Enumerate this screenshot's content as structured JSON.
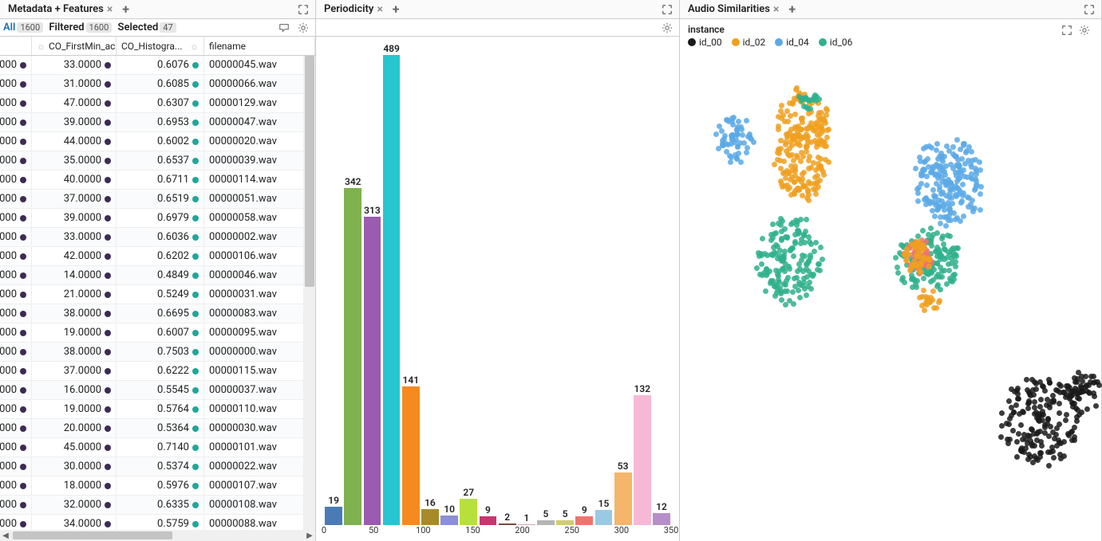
{
  "panels": {
    "left": {
      "title": "Metadata + Features"
    },
    "mid": {
      "title": "Periodicity"
    },
    "right": {
      "title": "Audio Similarities"
    }
  },
  "filters": {
    "all_label": "All",
    "all_count": "1600",
    "filtered_label": "Filtered",
    "filtered_count": "1600",
    "selected_label": "Selected",
    "selected_count": "47"
  },
  "table": {
    "headers": {
      "a": "CO_FirstMin_ac",
      "b": "CO_Histogra...",
      "c": "filename"
    },
    "rows": [
      {
        "idx": "000",
        "a": "33.0000",
        "b": "0.6076",
        "c": "00000045.wav"
      },
      {
        "idx": "000",
        "a": "31.0000",
        "b": "0.6085",
        "c": "00000066.wav"
      },
      {
        "idx": "000",
        "a": "47.0000",
        "b": "0.6307",
        "c": "00000129.wav"
      },
      {
        "idx": "000",
        "a": "39.0000",
        "b": "0.6953",
        "c": "00000047.wav"
      },
      {
        "idx": "000",
        "a": "44.0000",
        "b": "0.6002",
        "c": "00000020.wav"
      },
      {
        "idx": "000",
        "a": "35.0000",
        "b": "0.6537",
        "c": "00000039.wav"
      },
      {
        "idx": "000",
        "a": "40.0000",
        "b": "0.6711",
        "c": "00000114.wav"
      },
      {
        "idx": "000",
        "a": "37.0000",
        "b": "0.6519",
        "c": "00000051.wav"
      },
      {
        "idx": "000",
        "a": "39.0000",
        "b": "0.6979",
        "c": "00000058.wav"
      },
      {
        "idx": "000",
        "a": "33.0000",
        "b": "0.6036",
        "c": "00000002.wav"
      },
      {
        "idx": "000",
        "a": "42.0000",
        "b": "0.6202",
        "c": "00000106.wav"
      },
      {
        "idx": "000",
        "a": "14.0000",
        "b": "0.4849",
        "c": "00000046.wav"
      },
      {
        "idx": "000",
        "a": "21.0000",
        "b": "0.5249",
        "c": "00000031.wav"
      },
      {
        "idx": "000",
        "a": "38.0000",
        "b": "0.6695",
        "c": "00000083.wav"
      },
      {
        "idx": "000",
        "a": "19.0000",
        "b": "0.6007",
        "c": "00000095.wav"
      },
      {
        "idx": "000",
        "a": "38.0000",
        "b": "0.7503",
        "c": "00000000.wav"
      },
      {
        "idx": "000",
        "a": "37.0000",
        "b": "0.6222",
        "c": "00000115.wav"
      },
      {
        "idx": "000",
        "a": "16.0000",
        "b": "0.5545",
        "c": "00000037.wav"
      },
      {
        "idx": "000",
        "a": "19.0000",
        "b": "0.5764",
        "c": "00000110.wav"
      },
      {
        "idx": "000",
        "a": "20.0000",
        "b": "0.5364",
        "c": "00000030.wav"
      },
      {
        "idx": "000",
        "a": "45.0000",
        "b": "0.7140",
        "c": "00000101.wav"
      },
      {
        "idx": "000",
        "a": "30.0000",
        "b": "0.5374",
        "c": "00000022.wav"
      },
      {
        "idx": "000",
        "a": "18.0000",
        "b": "0.5976",
        "c": "00000107.wav"
      },
      {
        "idx": "000",
        "a": "32.0000",
        "b": "0.6335",
        "c": "00000108.wav"
      },
      {
        "idx": "000",
        "a": "34.0000",
        "b": "0.5759",
        "c": "00000088.wav"
      }
    ]
  },
  "chart_data": {
    "type": "bar",
    "title": "Periodicity",
    "xlabel": "",
    "ylabel": "",
    "x_ticks": [
      0,
      50,
      100,
      150,
      200,
      250,
      300,
      350
    ],
    "bars": [
      {
        "value": 19,
        "color": "#4a7bb7"
      },
      {
        "value": 342,
        "color": "#7fb14e"
      },
      {
        "value": 313,
        "color": "#9a5bb0"
      },
      {
        "value": 489,
        "color": "#25c6d0"
      },
      {
        "value": 141,
        "color": "#f58a1f"
      },
      {
        "value": 16,
        "color": "#a88a2a"
      },
      {
        "value": 10,
        "color": "#8a8fd6"
      },
      {
        "value": 27,
        "color": "#b8e03a"
      },
      {
        "value": 9,
        "color": "#c9356e"
      },
      {
        "value": 2,
        "color": "#7a4a3a"
      },
      {
        "value": 1,
        "color": "#d6a7b2"
      },
      {
        "value": 5,
        "color": "#b5b5b5"
      },
      {
        "value": 5,
        "color": "#d0cd6c"
      },
      {
        "value": 9,
        "color": "#f0746e"
      },
      {
        "value": 15,
        "color": "#9bc8e3"
      },
      {
        "value": 53,
        "color": "#f5b56a"
      },
      {
        "value": 132,
        "color": "#f7b8d6"
      },
      {
        "value": 12,
        "color": "#b78ec9"
      }
    ],
    "max": 489
  },
  "scatter": {
    "legend_title": "instance",
    "series": [
      {
        "name": "id_00",
        "color": "#1a1a1a"
      },
      {
        "name": "id_02",
        "color": "#f0a020"
      },
      {
        "name": "id_04",
        "color": "#5aa9e6"
      },
      {
        "name": "id_06",
        "color": "#2fb08c"
      }
    ]
  }
}
